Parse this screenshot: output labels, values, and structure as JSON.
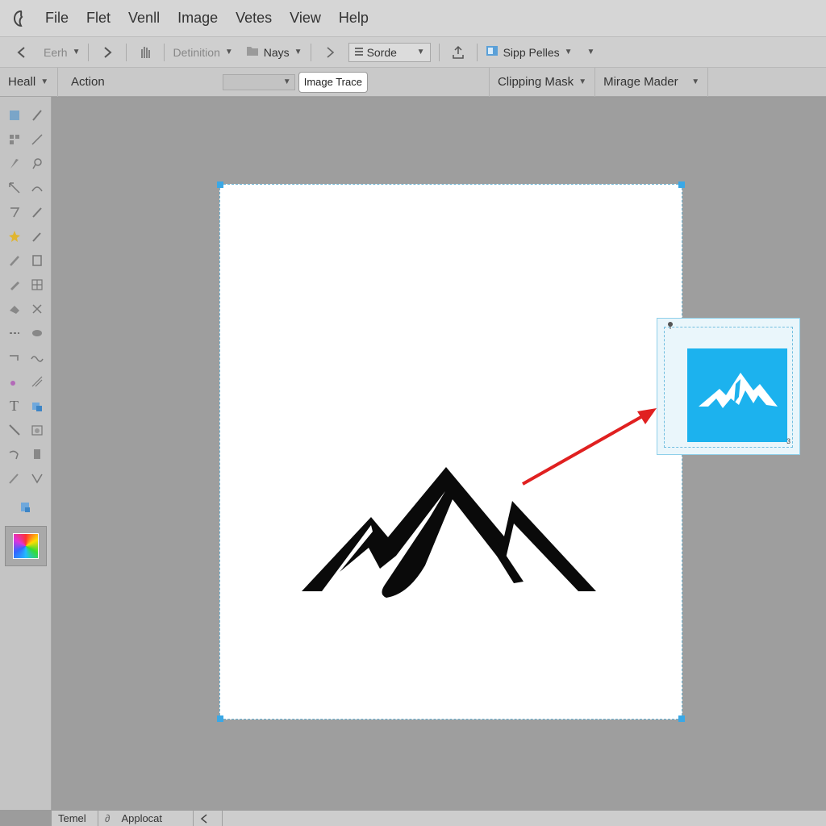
{
  "menubar": {
    "items": [
      "File",
      "Flet",
      "Venll",
      "Image",
      "Vetes",
      "View",
      "Help"
    ]
  },
  "controlbar": {
    "search_label": "Eerh",
    "defination_label": "Detinition",
    "nays_label": "Nays",
    "sorde_label": "Sorde",
    "sipp_label": "Sipp Pelles"
  },
  "optbar": {
    "head_label": "Heall",
    "action_label": "Action",
    "image_trace_label": "Image Trace",
    "clipping_mask_label": "Clipping Mask",
    "mirage_label": "Mirage Mader"
  },
  "statusbar": {
    "tab1": "Temel",
    "tab2": "Applocat"
  },
  "preview": {
    "corner_label": "3"
  },
  "colors": {
    "accent": "#1cb2ee",
    "arrow": "#e02020",
    "artboard_border": "#6fb6d6"
  }
}
